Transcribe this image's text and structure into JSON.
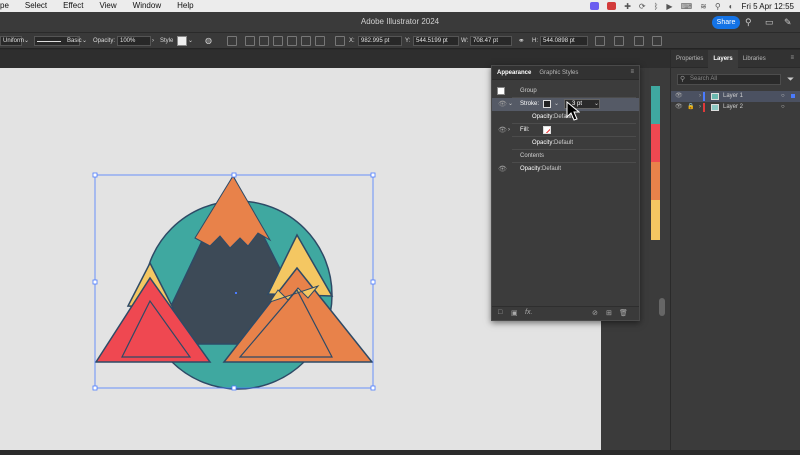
{
  "menubar": {
    "items": [
      "pe",
      "Select",
      "Effect",
      "View",
      "Window",
      "Help"
    ],
    "datetime": "Fri 5 Apr  12:55"
  },
  "titlebar": {
    "title": "Adobe Illustrator 2024",
    "share_label": "Share"
  },
  "control_bar": {
    "stroke_profile": "Uniform",
    "brush": "Basic",
    "opacity_label": "Opacity:",
    "opacity_value": "100%",
    "style_label": "Style",
    "x_label": "X:",
    "x_value": "982.995 pt",
    "y_label": "Y:",
    "y_value": "544.5199 pt",
    "w_label": "W:",
    "w_value": "708.47 pt",
    "h_label": "H:",
    "h_value": "544.0898 pt"
  },
  "appearance_panel": {
    "tabs": [
      "Appearance",
      "Graphic Styles"
    ],
    "group_label": "Group",
    "stroke_label": "Stroke:",
    "stroke_weight": "3 pt",
    "stroke_opacity_label": "Opacity:",
    "stroke_opacity_value": "Default",
    "fill_label": "Fill:",
    "fill_opacity_label": "Opacity:",
    "fill_opacity_value": "Default",
    "contents_label": "Contents",
    "group_opacity_label": "Opacity:",
    "group_opacity_value": "Default",
    "fx_label": "fx."
  },
  "layers_panel": {
    "tabs": [
      "Properties",
      "Layers",
      "Libraries"
    ],
    "search_placeholder": "Search All",
    "layers": [
      {
        "name": "Layer 1",
        "color": "#4a7bff"
      },
      {
        "name": "Layer 2",
        "color": "#e03a3a"
      }
    ]
  },
  "artwork_colors": {
    "teal": "#3fa8a0",
    "dark_slate": "#3d4a57",
    "orange": "#e8824a",
    "red": "#ef4851",
    "yellow": "#f4c762"
  },
  "swatch_strip": [
    "#3fa8a0",
    "#ef4851",
    "#e8824a",
    "#f4c762"
  ]
}
